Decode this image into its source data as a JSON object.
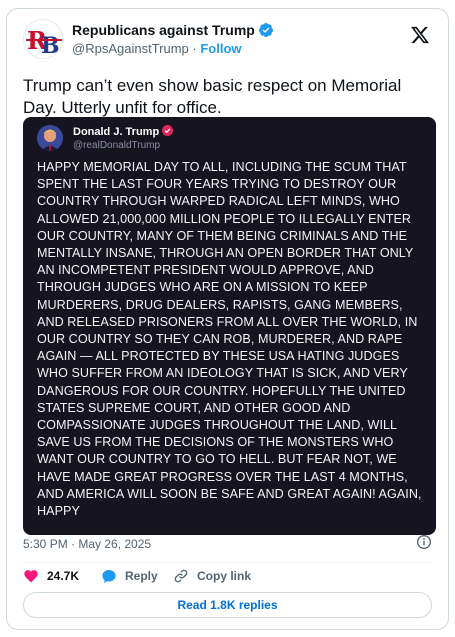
{
  "author": {
    "name": "Republicans against Trump",
    "handle": "@RpsAgainstTrump",
    "separator": "·",
    "follow_label": "Follow",
    "avatar_text": "RB",
    "verified_color": "#1d9bf0"
  },
  "tweet": {
    "text": "Trump can’t even show basic respect on Memorial Day. Utterly unfit for office.",
    "timestamp": "5:30 PM · May 26, 2025"
  },
  "embed": {
    "author_name": "Donald J. Trump",
    "author_handle": "@realDonaldTrump",
    "badge_color": "#e0245e",
    "text": "HAPPY MEMORIAL DAY TO ALL, INCLUDING THE SCUM THAT SPENT THE LAST FOUR YEARS TRYING TO DESTROY OUR COUNTRY THROUGH WARPED RADICAL LEFT MINDS, WHO ALLOWED 21,000,000 MILLION PEOPLE TO ILLEGALLY ENTER OUR COUNTRY, MANY OF THEM BEING CRIMINALS AND THE MENTALLY INSANE, THROUGH AN OPEN BORDER THAT ONLY AN INCOMPETENT PRESIDENT WOULD APPROVE, AND THROUGH JUDGES WHO ARE ON A MISSION TO KEEP MURDERERS, DRUG DEALERS, RAPISTS, GANG MEMBERS, AND RELEASED PRISONERS FROM ALL OVER THE WORLD, IN OUR COUNTRY SO THEY CAN ROB, MURDERER, AND RAPE AGAIN — ALL PROTECTED BY THESE USA HATING JUDGES WHO SUFFER FROM AN IDEOLOGY THAT IS SICK, AND VERY DANGEROUS FOR OUR COUNTRY. HOPEFULLY THE UNITED STATES SUPREME COURT, AND OTHER GOOD AND COMPASSIONATE JUDGES THROUGHOUT THE LAND, WILL SAVE US FROM THE DECISIONS OF THE MONSTERS WHO WANT OUR COUNTRY TO GO TO HELL. BUT FEAR NOT, WE HAVE MADE GREAT PROGRESS OVER THE LAST 4 MONTHS, AND AMERICA WILL SOON BE SAFE AND GREAT AGAIN! AGAIN, HAPPY"
  },
  "actions": {
    "likes_count": "24.7K",
    "reply_label": "Reply",
    "copy_link_label": "Copy link",
    "read_replies_label": "Read 1.8K replies",
    "like_color": "#f91880"
  },
  "icons": {
    "verified": "verified-check-icon",
    "x_logo": "x-logo-icon",
    "info": "info-icon",
    "heart": "heart-icon",
    "reply": "reply-bubble-icon",
    "link": "link-icon"
  }
}
